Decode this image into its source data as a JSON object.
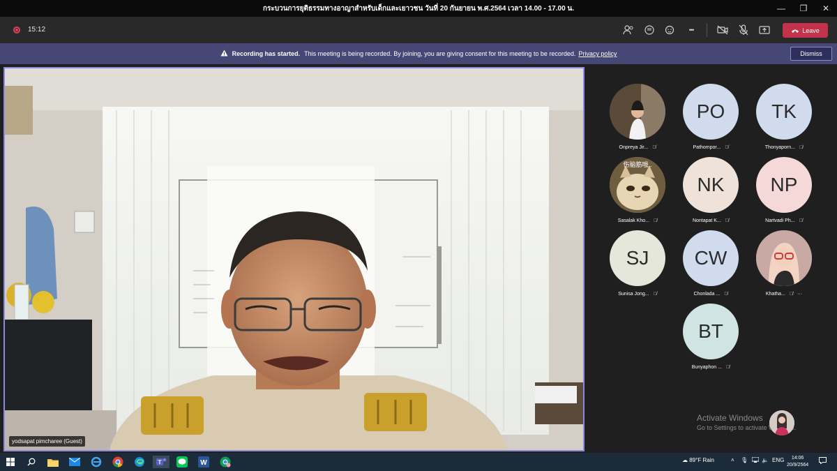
{
  "window": {
    "title": "กระบวนการยุติธรรมทางอาญาสำหรับเด็กและเยาวชน วันที่ 20 กันยายน พ.ศ.2564 เวลา 14.00 - 17.00 น.",
    "minimize": "—",
    "maximize": "❐",
    "close": "✕"
  },
  "toolbar": {
    "timer": "15:12",
    "leave_label": "Leave",
    "more_label": "•••"
  },
  "banner": {
    "bold": "Recording has started.",
    "message": "This meeting is being recorded. By joining, you are giving consent for this meeting to be recorded.",
    "link": "Privacy policy",
    "dismiss": "Dismiss"
  },
  "main_video": {
    "name": "yodsapat pimcharee (Guest)"
  },
  "participants": [
    {
      "initials": "",
      "name": "Onpreya Jir...",
      "color": "#7a6a55",
      "photo": true
    },
    {
      "initials": "PO",
      "name": "Pathompor...",
      "color": "#d0dced"
    },
    {
      "initials": "TK",
      "name": "Thonyaporn...",
      "color": "#d0dced"
    },
    {
      "initials": "",
      "name": "Sasalak Kho...",
      "color": "#b79a6c",
      "photo": true
    },
    {
      "initials": "NK",
      "name": "Nontapat K...",
      "color": "#efe3d9"
    },
    {
      "initials": "NP",
      "name": "Nartvadi Ph...",
      "color": "#f5d8d8"
    },
    {
      "initials": "SJ",
      "name": "Sunisa Jong...",
      "color": "#e4e7da"
    },
    {
      "initials": "CW",
      "name": "Chonlada ...",
      "color": "#d0dced"
    },
    {
      "initials": "",
      "name": "Khatha...",
      "color": "#d9b3ad",
      "photo": true
    },
    {
      "initials": "BT",
      "name": "Bunyaphon ...",
      "color": "#d0e5e3"
    }
  ],
  "cat_caption": "伤脑筋哦..",
  "tile_more": "···",
  "activate": {
    "title": "Activate Windows",
    "subtitle": "Go to Settings to activate Windows."
  },
  "taskbar": {
    "weather": "89°F  Rain",
    "lang": "ENG",
    "time": "14:06",
    "date": "20/9/2564"
  },
  "colors": {
    "leave": "#c4314b",
    "banner": "#464775",
    "active_border": "#8b8ce0"
  }
}
